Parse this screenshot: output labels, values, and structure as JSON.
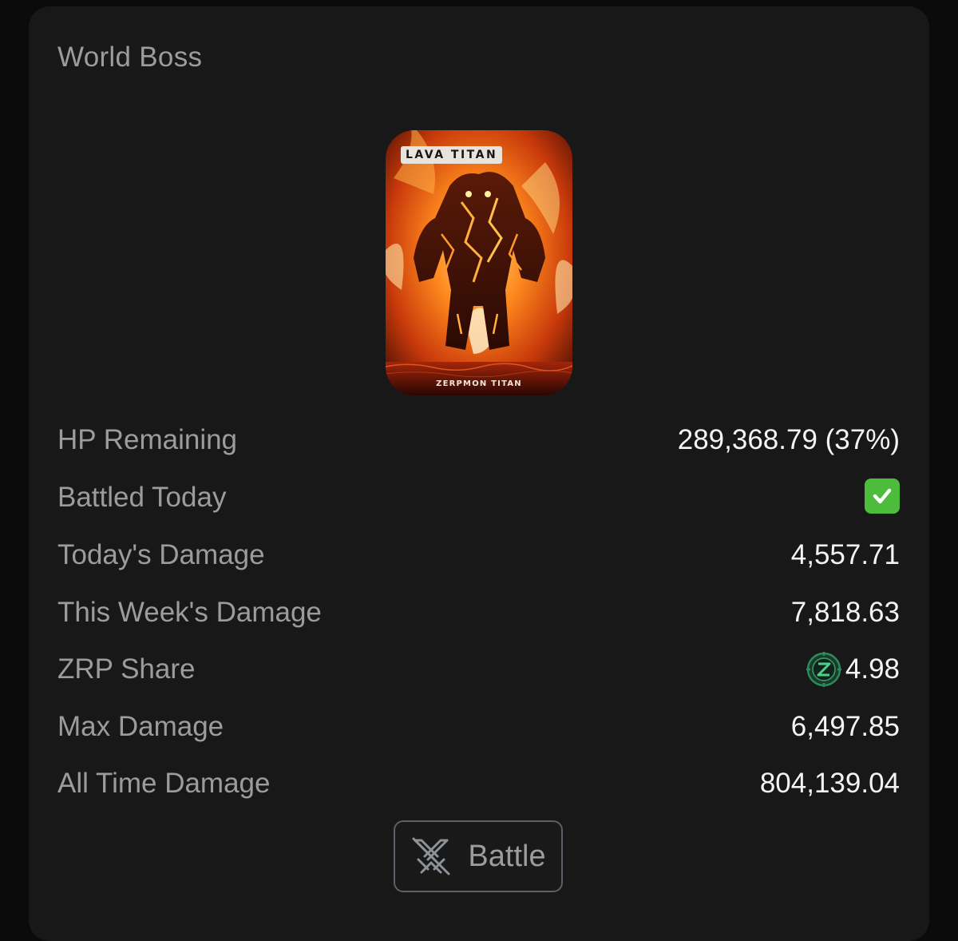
{
  "card": {
    "title": "World Boss"
  },
  "boss": {
    "name": "LAVA TITAN",
    "footer": "ZERPMON TITAN",
    "image_description_icon": "lava-titan-artwork"
  },
  "stats": [
    {
      "label": "HP Remaining",
      "value": "289,368.79 (37%)"
    },
    {
      "label": "Battled Today",
      "value": "",
      "icon": "check-mark-icon"
    },
    {
      "label": "Today's Damage",
      "value": "4,557.71"
    },
    {
      "label": "This Week's Damage",
      "value": "7,818.63"
    },
    {
      "label": "ZRP Share",
      "value": "4.98",
      "icon": "zrp-token-icon"
    },
    {
      "label": "Max Damage",
      "value": "6,497.85"
    },
    {
      "label": "All Time Damage",
      "value": "804,139.04"
    }
  ],
  "hp_percent": 37,
  "battle_button": {
    "label": "Battle",
    "icon": "crossed-swords-icon"
  },
  "colors": {
    "background": "#0b0b0b",
    "card": "#181818",
    "label": "#9c9c9c",
    "value": "#f4f4f4",
    "check_green": "#4dbb3c",
    "zrp_green": "#2d8a5a"
  }
}
